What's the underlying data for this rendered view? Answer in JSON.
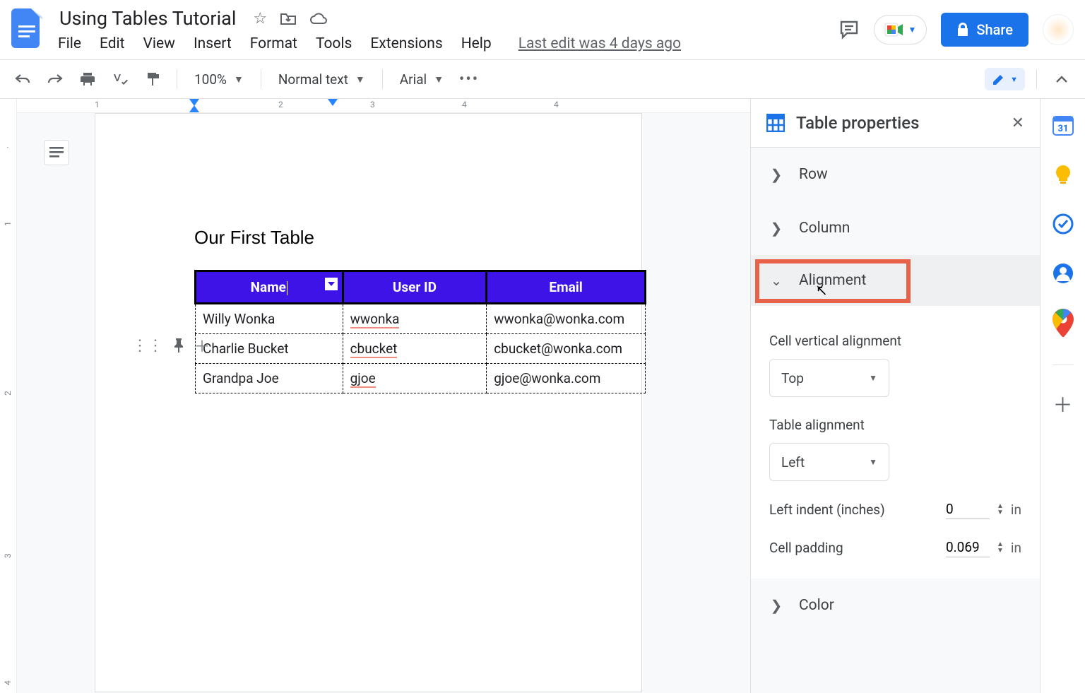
{
  "header": {
    "doc_title": "Using Tables Tutorial",
    "menus": [
      "File",
      "Edit",
      "View",
      "Insert",
      "Format",
      "Tools",
      "Extensions",
      "Help"
    ],
    "last_edit": "Last edit was 4 days ago",
    "share_label": "Share"
  },
  "toolbar": {
    "zoom": "100%",
    "style": "Normal text",
    "font": "Arial"
  },
  "ruler": {
    "h_marks": [
      "1",
      "2",
      "3",
      "4"
    ],
    "v_marks": [
      "1",
      "2",
      "3",
      "4"
    ]
  },
  "document": {
    "heading": "Our First Table",
    "table": {
      "headers": [
        "Name",
        "User ID",
        "Email"
      ],
      "rows": [
        {
          "name": "Willy Wonka",
          "user_id": "wwonka",
          "email": "wwonka@wonka.com"
        },
        {
          "name": "Charlie Bucket",
          "user_id": "cbucket",
          "email": "cbucket@wonka.com"
        },
        {
          "name": "Grandpa Joe",
          "user_id": "gjoe",
          "email": "gjoe@wonka.com"
        }
      ]
    }
  },
  "side_panel": {
    "title": "Table properties",
    "sections": {
      "row": "Row",
      "column": "Column",
      "alignment": "Alignment",
      "color": "Color"
    },
    "alignment": {
      "cell_vertical_label": "Cell vertical alignment",
      "cell_vertical_value": "Top",
      "table_alignment_label": "Table alignment",
      "table_alignment_value": "Left",
      "left_indent_label": "Left indent (inches)",
      "left_indent_value": "0",
      "left_indent_unit": "in",
      "cell_padding_label": "Cell padding",
      "cell_padding_value": "0.069",
      "cell_padding_unit": "in"
    }
  },
  "rail": {
    "calendar_day": "31"
  }
}
